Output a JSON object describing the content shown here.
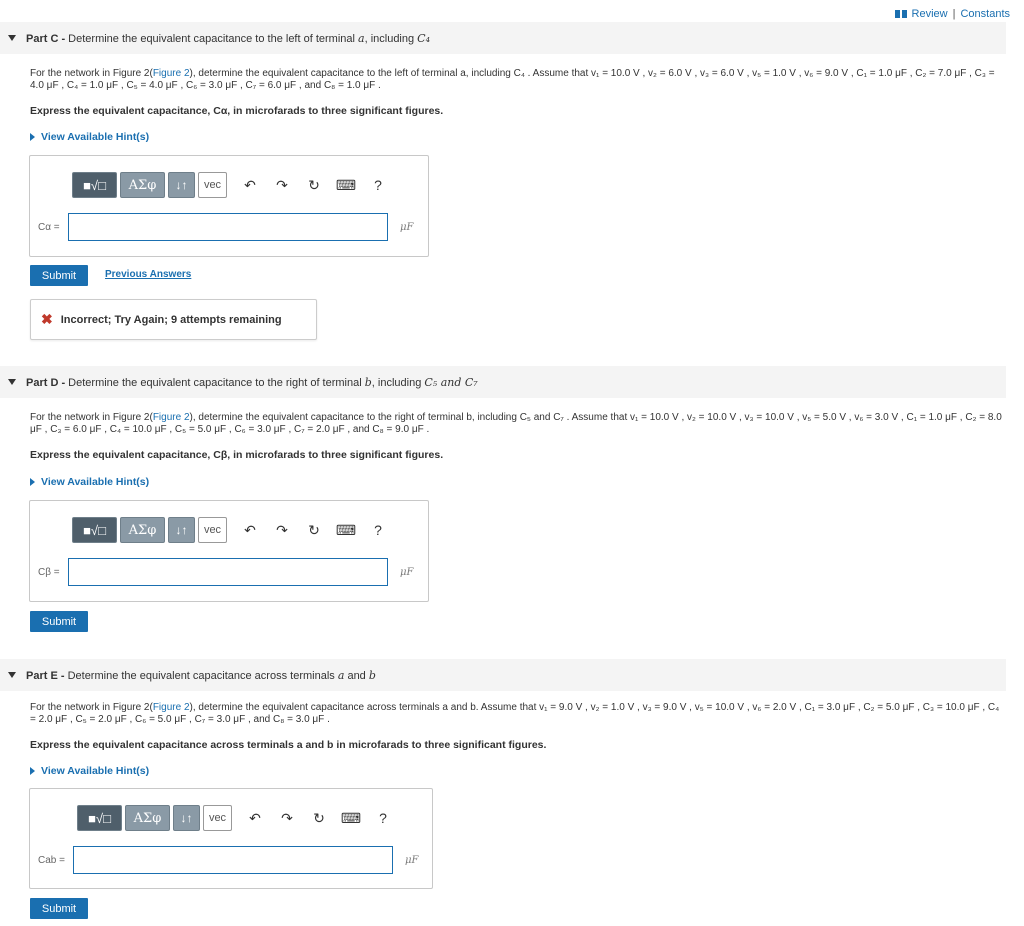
{
  "top": {
    "review": "Review",
    "sep": "|",
    "constants": "Constants"
  },
  "parts": [
    {
      "header_bold": "Part C -",
      "header_rest": " Determine the equivalent capacitance to the left of terminal ",
      "header_term": "a",
      "header_mid": ", including ",
      "header_var": "C₄",
      "para_pre": "For the network in Figure 2(",
      "para_link": "Figure 2",
      "para_post": "), determine the equivalent capacitance to the left of terminal a, including C₄ . Assume that v₁ = 10.0 V , v₂ = 6.0 V , v₃ = 6.0 V , v₅ = 1.0 V , v₆ = 9.0 V , C₁ = 1.0 μF , C₂ = 7.0 μF , C₃ = 4.0 μF , C₄ = 1.0 μF , C₅ = 4.0 μF , C₆ = 3.0 μF , C₇ = 6.0 μF , and C₈ = 1.0 μF .",
      "express": "Express the equivalent capacitance, Cα, in microfarads to three significant figures.",
      "hint": "View Available Hint(s)",
      "var_label": "Cα =",
      "unit": "μF",
      "submit": "Submit",
      "previous": "Previous Answers",
      "feedback": "Incorrect; Try Again; 9 attempts remaining"
    },
    {
      "header_bold": "Part D -",
      "header_rest": " Determine the equivalent capacitance to the right of terminal ",
      "header_term": "b",
      "header_mid": ", including ",
      "header_var": "C₅ and C₇",
      "para_pre": "For the network in Figure 2(",
      "para_link": "Figure 2",
      "para_post": "), determine the equivalent capacitance to the right of terminal b, including C₅ and C₇ . Assume that v₁ = 10.0 V , v₂ = 10.0 V , v₃ = 10.0 V , v₅ = 5.0 V , v₆ = 3.0 V , C₁ = 1.0 μF , C₂ = 8.0 μF , C₃ = 6.0 μF , C₄ = 10.0 μF , C₅ = 5.0 μF , C₆ = 3.0 μF , C₇ = 2.0 μF , and C₈ = 9.0 μF .",
      "express": "Express the equivalent capacitance, Cβ, in microfarads to three significant figures.",
      "hint": "View Available Hint(s)",
      "var_label": "Cβ =",
      "unit": "μF",
      "submit": "Submit"
    },
    {
      "header_bold": "Part E -",
      "header_rest": " Determine the equivalent capacitance across terminals ",
      "header_term": "a",
      "header_mid": " and ",
      "header_var": "b",
      "para_pre": "For the network in Figure 2(",
      "para_link": "Figure 2",
      "para_post": "), determine the equivalent capacitance across terminals a and b. Assume that v₁ = 9.0 V , v₂ = 1.0 V , v₃ = 9.0 V , v₅ = 10.0 V , v₆ = 2.0 V , C₁ = 3.0 μF , C₂ = 5.0 μF , C₃ = 10.0 μF , C₄ = 2.0 μF , C₅ = 2.0 μF , C₆ = 5.0 μF , C₇ = 3.0 μF , and C₈ = 3.0 μF .",
      "express": "Express the equivalent capacitance across terminals a and b in microfarads to three significant figures.",
      "hint": "View Available Hint(s)",
      "var_label": "Cab =",
      "unit": "μF",
      "submit": "Submit"
    }
  ],
  "toolbar": {
    "sqrt": "■√□",
    "greek": "ΑΣφ",
    "arrows": "↓↑",
    "vec": "vec",
    "undo": "↶",
    "redo": "↷",
    "reset": "↻",
    "keyboard": "⌨",
    "help": "?"
  }
}
